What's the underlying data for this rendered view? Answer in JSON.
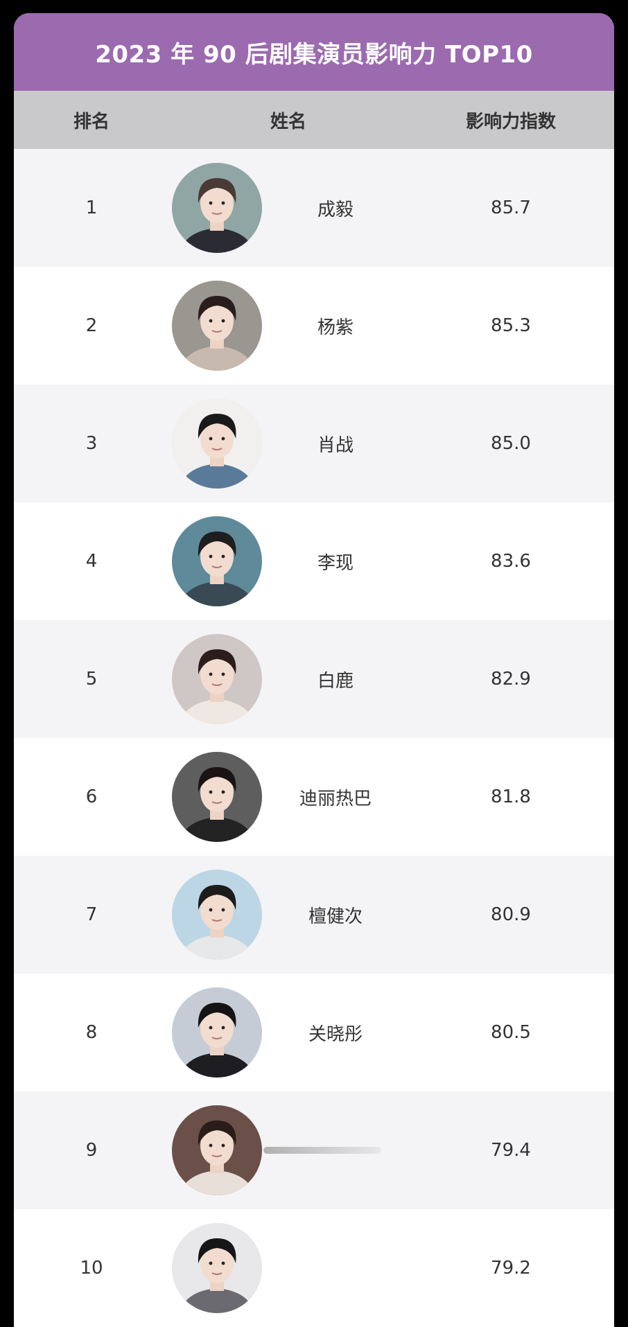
{
  "title": "2023 年 90 后剧集演员影响力 TOP10",
  "headers": {
    "rank": "排名",
    "name": "姓名",
    "score": "影响力指数"
  },
  "colors": {
    "title_bg": "#9b6aaf",
    "header_bg": "#c9c9cc",
    "row_alt_bg": "#f4f4f6"
  },
  "rows": [
    {
      "rank": "1",
      "name": "成毅",
      "score": "85.7",
      "avatar_bg": "#8fa6a4",
      "hair": "#4a3a36",
      "shirt": "#2b2b33"
    },
    {
      "rank": "2",
      "name": "杨紫",
      "score": "85.3",
      "avatar_bg": "#9a9690",
      "hair": "#2a1e1c",
      "shirt": "#c7b9ad"
    },
    {
      "rank": "3",
      "name": "肖战",
      "score": "85.0",
      "avatar_bg": "#f2f0ee",
      "hair": "#1a1a1a",
      "shirt": "#5a7a9a"
    },
    {
      "rank": "4",
      "name": "李现",
      "score": "83.6",
      "avatar_bg": "#5e8a9a",
      "hair": "#1e1e1e",
      "shirt": "#3a4a55"
    },
    {
      "rank": "5",
      "name": "白鹿",
      "score": "82.9",
      "avatar_bg": "#cfc6c6",
      "hair": "#2a1d1b",
      "shirt": "#efe8e2"
    },
    {
      "rank": "6",
      "name": "迪丽热巴",
      "score": "81.8",
      "avatar_bg": "#5e5e5e",
      "hair": "#1b1414",
      "shirt": "#232323"
    },
    {
      "rank": "7",
      "name": "檀健次",
      "score": "80.9",
      "avatar_bg": "#bcd6e6",
      "hair": "#1c1c1c",
      "shirt": "#e6e8ea"
    },
    {
      "rank": "8",
      "name": "关晓彤",
      "score": "80.5",
      "avatar_bg": "#c6ccd6",
      "hair": "#141414",
      "shirt": "#1d1d22"
    },
    {
      "rank": "9",
      "name": "",
      "score": "79.4",
      "avatar_bg": "#6a5048",
      "hair": "#2a1c18",
      "shirt": "#e9dfd9"
    },
    {
      "rank": "10",
      "name": "",
      "score": "79.2",
      "avatar_bg": "#e8e8ea",
      "hair": "#161616",
      "shirt": "#6a6a70"
    }
  ]
}
